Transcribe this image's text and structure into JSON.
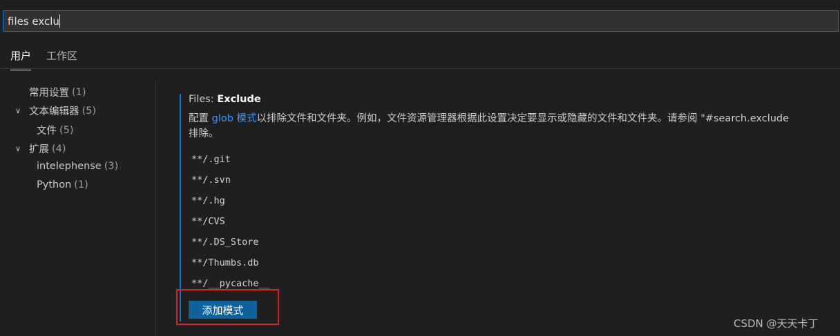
{
  "search": {
    "value": "files exclu"
  },
  "tabs": [
    {
      "label": "用户"
    },
    {
      "label": "工作区"
    }
  ],
  "toc": {
    "items": [
      {
        "label": "常用设置",
        "count": "(1)"
      },
      {
        "label": "文本编辑器",
        "count": "(5)"
      },
      {
        "label": "文件",
        "count": "(5)"
      },
      {
        "label": "扩展",
        "count": "(4)"
      },
      {
        "label": "intelephense",
        "count": "(3)"
      },
      {
        "label": "Python",
        "count": "(1)"
      }
    ]
  },
  "setting": {
    "category": "Files: ",
    "name": "Exclude",
    "desc_prefix": "配置 ",
    "desc_link": "glob 模式",
    "desc_rest": "以排除文件和文件夹。例如，文件资源管理器根据此设置决定要显示或隐藏的文件和文件夹。请参阅 \"#search.exclude",
    "desc_line2": "排除。",
    "patterns": [
      "**/.git",
      "**/.svn",
      "**/.hg",
      "**/CVS",
      "**/.DS_Store",
      "**/Thumbs.db",
      "**/__pycache__"
    ],
    "add_button_label": "添加模式"
  },
  "watermark": "CSDN @天天卡丁",
  "colors": {
    "accent": "#0078d4",
    "button": "#0e639c",
    "link": "#3794ff",
    "highlight_box": "#e02020"
  }
}
